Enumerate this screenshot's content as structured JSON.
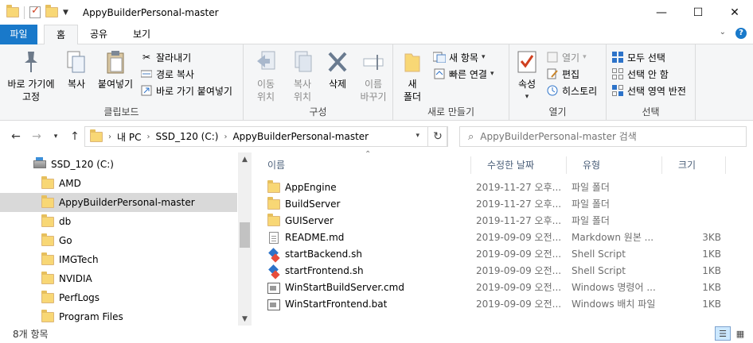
{
  "window": {
    "title": "AppyBuilderPersonal-master",
    "minimize_glyph": "—",
    "maximize_glyph": "☐",
    "close_glyph": "✕"
  },
  "ribbon_tabs": {
    "file": "파일",
    "home": "홈",
    "share": "공유",
    "view": "보기"
  },
  "ribbon": {
    "clipboard": {
      "label": "클립보드",
      "pin": "바로 가기에\n고정",
      "copy": "복사",
      "paste": "붙여넣기",
      "cut": "잘라내기",
      "copy_path": "경로 복사",
      "paste_shortcut": "바로 가기 붙여넣기"
    },
    "organize": {
      "label": "구성",
      "move_to": "이동\n위치",
      "copy_to": "복사\n위치",
      "delete": "삭제",
      "rename": "이름\n바꾸기"
    },
    "new": {
      "label": "새로 만들기",
      "new_folder": "새\n폴더",
      "new_item": "새 항목",
      "easy_access": "빠른 연결"
    },
    "open": {
      "label": "열기",
      "properties": "속성",
      "open": "열기",
      "edit": "편집",
      "history": "히스토리"
    },
    "select": {
      "label": "선택",
      "select_all": "모두 선택",
      "select_none": "선택 안 함",
      "invert": "선택 영역 반전"
    }
  },
  "address": {
    "crumbs": [
      "내 PC",
      "SSD_120 (C:)",
      "AppyBuilderPersonal-master"
    ],
    "search_placeholder": "AppyBuilderPersonal-master 검색"
  },
  "nav_pane": {
    "drive": "SSD_120 (C:)",
    "folders": [
      "AMD",
      "AppyBuilderPersonal-master",
      "db",
      "Go",
      "IMGTech",
      "NVIDIA",
      "PerfLogs",
      "Program Files"
    ],
    "selected_index": 1
  },
  "file_list": {
    "columns": {
      "name": "이름",
      "date": "수정한 날짜",
      "type": "유형",
      "size": "크기"
    },
    "rows": [
      {
        "name": "AppEngine",
        "date": "2019-11-27 오후...",
        "type": "파일 폴더",
        "size": "",
        "icon": "folder"
      },
      {
        "name": "BuildServer",
        "date": "2019-11-27 오후...",
        "type": "파일 폴더",
        "size": "",
        "icon": "folder"
      },
      {
        "name": "GUIServer",
        "date": "2019-11-27 오후...",
        "type": "파일 폴더",
        "size": "",
        "icon": "folder"
      },
      {
        "name": "README.md",
        "date": "2019-09-09 오전...",
        "type": "Markdown 원본 ...",
        "size": "3KB",
        "icon": "document"
      },
      {
        "name": "startBackend.sh",
        "date": "2019-09-09 오전...",
        "type": "Shell Script",
        "size": "1KB",
        "icon": "shell-script"
      },
      {
        "name": "startFrontend.sh",
        "date": "2019-09-09 오전...",
        "type": "Shell Script",
        "size": "1KB",
        "icon": "shell-script"
      },
      {
        "name": "WinStartBuildServer.cmd",
        "date": "2019-09-09 오전...",
        "type": "Windows 명령어 ...",
        "size": "1KB",
        "icon": "command"
      },
      {
        "name": "WinStartFrontend.bat",
        "date": "2019-09-09 오전...",
        "type": "Windows 배치 파일",
        "size": "1KB",
        "icon": "command"
      }
    ]
  },
  "status": {
    "item_count": "8개 항목"
  },
  "colors": {
    "file_tab": "#1979ca",
    "selection": "#d9d9d9",
    "ribbon_bg": "#f5f6f7"
  }
}
